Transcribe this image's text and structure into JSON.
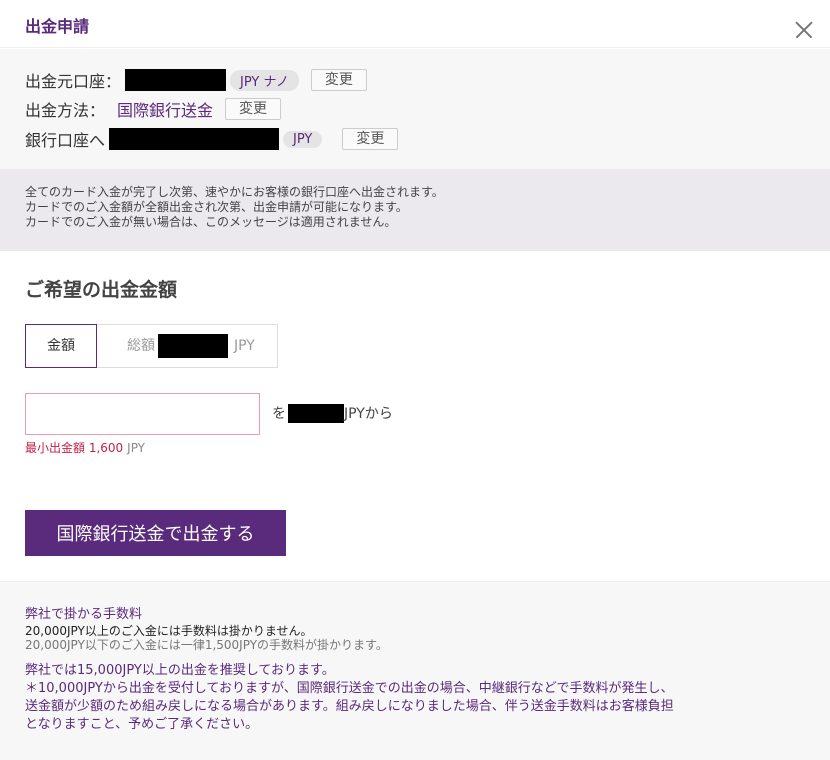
{
  "header": {
    "title": "出金申請"
  },
  "account_info": {
    "source_label": "出金元口座：",
    "source_currency_badge": "JPY ナノ",
    "method_label": "出金方法：",
    "method_value": "国際銀行送金",
    "bank_label": "銀行口座へ",
    "bank_currency_badge": "JPY",
    "change_label": "変更"
  },
  "notice": {
    "lines": [
      "全てのカード入金が完了し次第、速やかにお客様の銀行口座へ出金されます。",
      "カードでのご入金額が全額出金され次第、出金申請が可能になります。",
      "カードでのご入金が無い場合は、このメッセージは適用されません。"
    ]
  },
  "withdraw": {
    "section_title": "ご希望の出金金額",
    "tab_amount": "金額",
    "tab_total_prefix": "総額",
    "tab_total_suffix": "JPY",
    "input_value": "",
    "from_prefix": "を",
    "from_suffix": "JPYから",
    "min_label": "最小出金額 1,600",
    "min_unit": "JPY",
    "submit_label": "国際銀行送金で出金する"
  },
  "fees": {
    "title": "弊社で掛かる手数料",
    "line1": "20,000JPY以上のご入金には手数料は掛かりません。",
    "line2": "20,000JPY以下のご入金には一律1,500JPYの手数料が掛かります。",
    "rec1": "弊社では15,000JPY以上の出金を推奨しております。",
    "rec2": "＊10,000JPYから出金を受付しておりますが、国際銀行送金での出金の場合、中継銀行などで手数料が発生し、",
    "rec3": "送金額が少額のため組み戻しになる場合があります。組み戻しになりました場合、伴う送金手数料はお客様負担",
    "rec4": "となりますこと、予めご了承ください。"
  },
  "colors": {
    "accent": "#5a2a7c",
    "error": "#c0234a"
  }
}
